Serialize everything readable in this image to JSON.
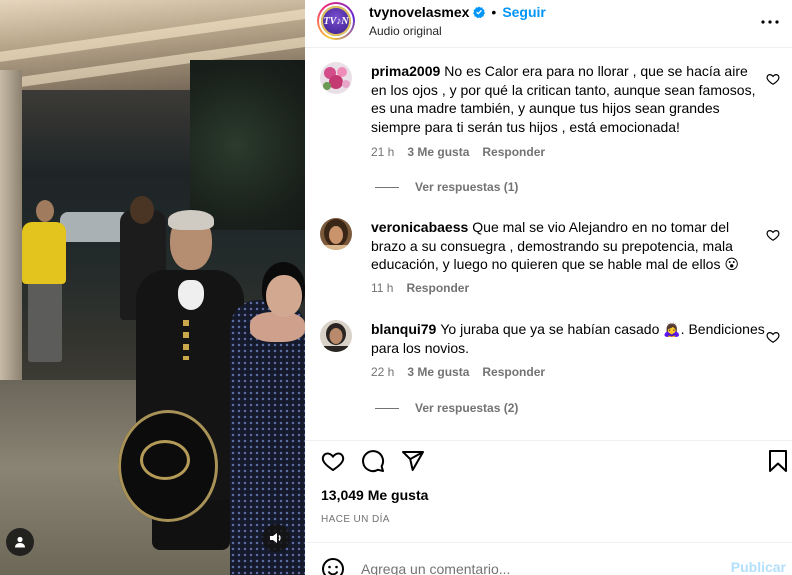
{
  "colors": {
    "accent": "#0095f6",
    "secondary_text": "#737373",
    "post_disabled": "#b2dffc",
    "verified": "#0095f6"
  },
  "media": {
    "tag_icon": "person-icon",
    "mute_icon": "speaker-icon"
  },
  "header": {
    "avatar_text": "TV♪N",
    "username": "tvynovelasmex",
    "dot": "•",
    "follow_label": "Seguir",
    "audio_label": "Audio original",
    "more_icon": "more-horizontal-icon"
  },
  "comments": [
    {
      "username": "prima2009",
      "text": "No es Calor era para no llorar , que se hacía aire en los ojos , y por qué la critican tanto, aunque sean famosos, es una madre también, y aunque tus hijos sean grandes siempre para ti serán tus hijos , está emocionada!",
      "time": "21 h",
      "likes": "3 Me gusta",
      "reply_label": "Responder",
      "view_replies": "Ver respuestas (1)"
    },
    {
      "username": "veronicabaess",
      "text": "Que mal se vio Alejandro en no tomar del brazo a su consuegra , demostrando su prepotencia, mala educación, y luego no quieren que se hable mal de ellos 😮",
      "time": "11 h",
      "likes": "",
      "reply_label": "Responder",
      "view_replies": ""
    },
    {
      "username": "blanqui79",
      "text": "Yo juraba que ya se habían casado 🙇‍♀️. Bendiciones para los novios.",
      "time": "22 h",
      "likes": "3 Me gusta",
      "reply_label": "Responder",
      "view_replies": "Ver respuestas (2)"
    }
  ],
  "actions": {
    "like_icon": "heart-icon",
    "comment_icon": "comment-icon",
    "share_icon": "send-icon",
    "save_icon": "bookmark-icon"
  },
  "likes_count": "13,049 Me gusta",
  "posted_time": "HACE UN DÍA",
  "comment_box": {
    "emoji_icon": "emoji-icon",
    "placeholder": "Agrega un comentario...",
    "post_label": "Publicar"
  }
}
